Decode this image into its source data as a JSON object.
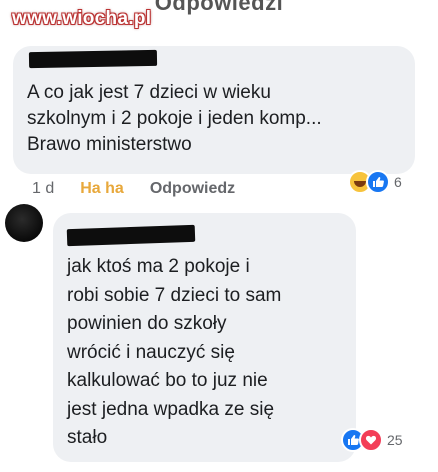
{
  "header": {
    "title": "Odpowiedzi"
  },
  "watermark": {
    "text": "www.wiocha.pl"
  },
  "comment1": {
    "text": "A co jak jest 7 dzieci w wieku\nszkolnym i 2 pokoje i jeden komp...\nBrawo ministerstwo",
    "time": "1 d",
    "reaction_label": "Ha ha",
    "reply_label": "Odpowiedz",
    "reactions": {
      "icons": [
        "haha-icon",
        "like-icon"
      ],
      "count": "6"
    }
  },
  "comment2": {
    "text": "jak ktoś ma 2 pokoje i\nrobi sobie 7 dzieci to sam\npowinien do szkoły\nwrócić i nauczyć się\nkalkulować bo to juz nie\njest jedna wpadka ze się\nstało",
    "reactions": {
      "icons": [
        "like-icon",
        "love-icon"
      ],
      "count": "25"
    }
  },
  "colors": {
    "bubble": "#eef0f3",
    "like": "#1877f2",
    "love": "#f33e58",
    "haha": "#f7c33c",
    "haha_text": "#e8a83b",
    "muted": "#65676b"
  }
}
